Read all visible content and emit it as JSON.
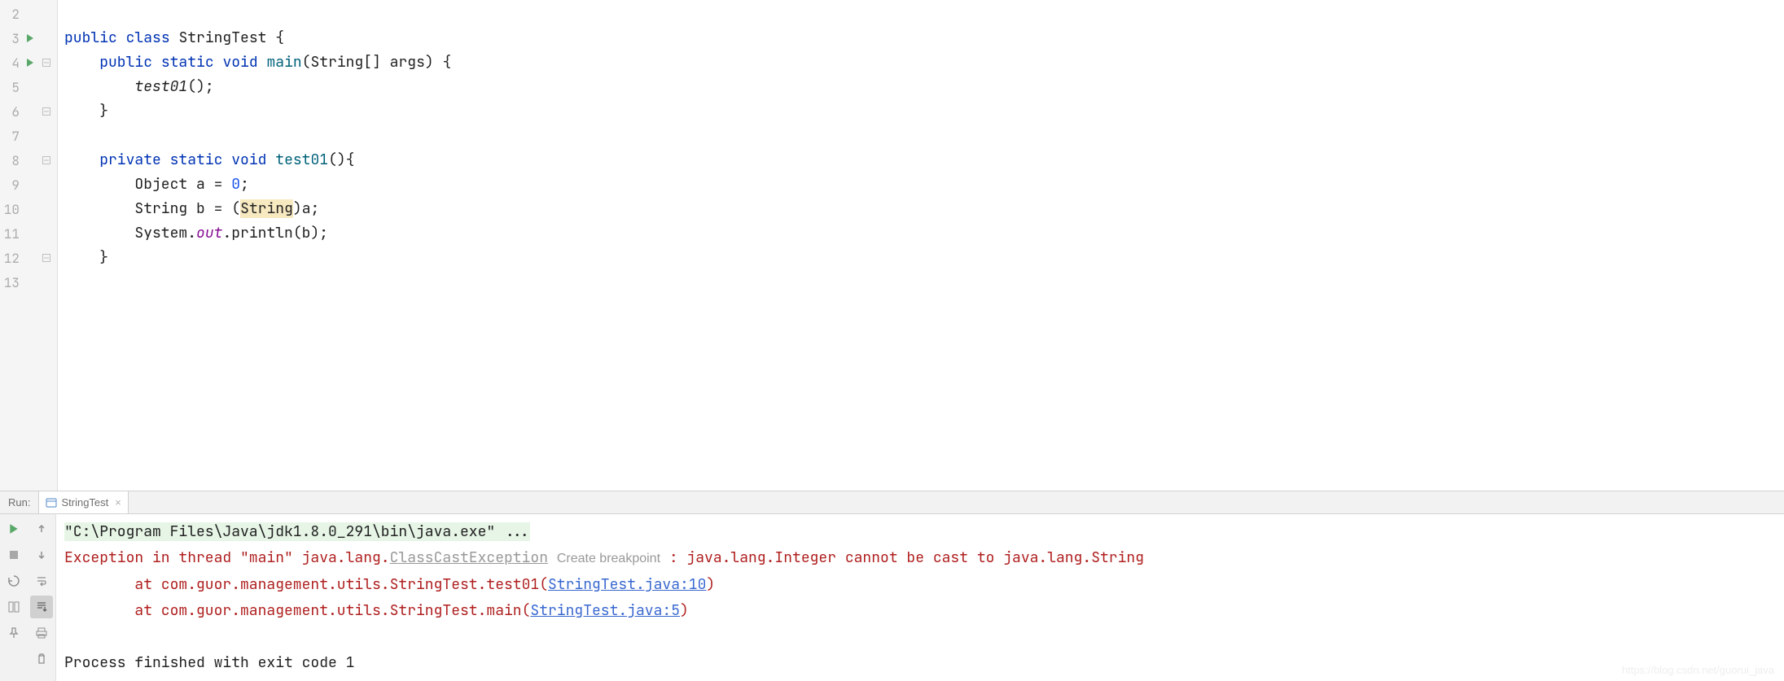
{
  "editor": {
    "lines": [
      {
        "num": 2,
        "run": false,
        "fold": null
      },
      {
        "num": 3,
        "run": true,
        "fold": null
      },
      {
        "num": 4,
        "run": true,
        "fold": "open"
      },
      {
        "num": 5,
        "run": false,
        "fold": null
      },
      {
        "num": 6,
        "run": false,
        "fold": "close"
      },
      {
        "num": 7,
        "run": false,
        "fold": null
      },
      {
        "num": 8,
        "run": false,
        "fold": "open"
      },
      {
        "num": 9,
        "run": false,
        "fold": null
      },
      {
        "num": 10,
        "run": false,
        "fold": null
      },
      {
        "num": 11,
        "run": false,
        "fold": null
      },
      {
        "num": 12,
        "run": false,
        "fold": "close"
      },
      {
        "num": 13,
        "run": false,
        "fold": null
      }
    ],
    "tokens": {
      "public": "public",
      "class": "class",
      "StringTest": "StringTest",
      "static": "static",
      "void": "void",
      "main": "main",
      "String_arr_args": "String[] args",
      "test01_call": "test01",
      "private": "private",
      "test01_def": "test01",
      "Object": "Object",
      "a": "a",
      "eq": "=",
      "zero": "0",
      "String": "String",
      "b": "b",
      "cast_String": "String",
      "System": "System",
      "out": "out",
      "println": "println"
    }
  },
  "run": {
    "label": "Run:",
    "tab_name": "StringTest",
    "console": {
      "cmd": "\"C:\\Program Files\\Java\\jdk1.8.0_291\\bin\\java.exe\" ...",
      "err_prefix": "Exception in thread \"main\" java.lang.",
      "err_class": "ClassCastException",
      "breakpoint_hint": "Create breakpoint",
      "err_suffix": " : java.lang.Integer cannot be cast to java.lang.String",
      "at1_prefix": "        at com.guor.management.utils.StringTest.test01(",
      "at1_link": "StringTest.java:10",
      "at2_prefix": "        at com.guor.management.utils.StringTest.main(",
      "at2_link": "StringTest.java:5",
      "exit": "Process finished with exit code 1"
    }
  },
  "watermark": "https://blog.csdn.net/guorui_java"
}
